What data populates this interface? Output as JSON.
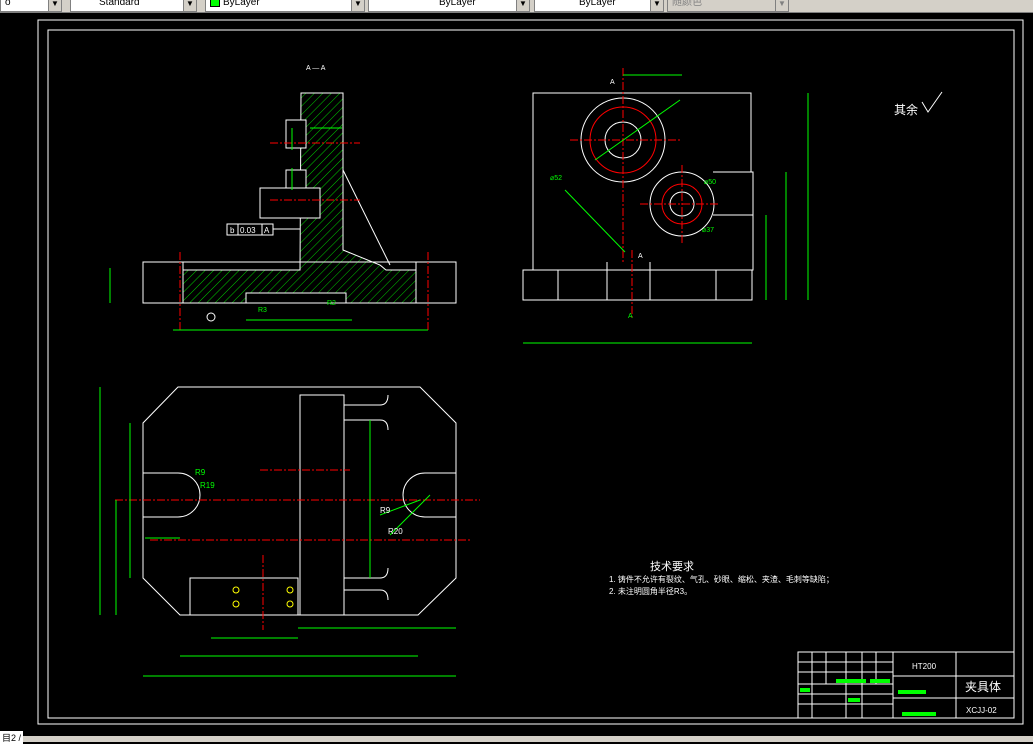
{
  "toolbar": {
    "combos": [
      {
        "id": "textstyle-left",
        "value": "o"
      },
      {
        "id": "dimstyle",
        "value": "Standard"
      },
      {
        "id": "layer",
        "value": "ByLayer"
      },
      {
        "id": "linetype",
        "value": "ByLayer"
      },
      {
        "id": "lineweight",
        "value": "ByLayer"
      },
      {
        "id": "plotstyle",
        "value": "随颜色"
      }
    ]
  },
  "drawing": {
    "section_label": "A — A",
    "roughness_note": "其余",
    "tolerance_frame": {
      "symbol": "b",
      "value": "0.03",
      "datum": "A"
    },
    "tech_requirements": {
      "title": "技术要求",
      "lines": [
        "1. 铸件不允许有裂纹、气孔、砂眼、缩松、夹渣、毛刺等缺陷；",
        "2. 未注明圆角半径R3。"
      ]
    },
    "labels": {
      "r9_left": "R9",
      "r19": "R19",
      "r9_right": "R9",
      "r20": "R20",
      "r3": "R3",
      "r2": "R2",
      "d52": "⌀52",
      "d50": "⌀50",
      "d37": "⌀37",
      "a_top": "A",
      "a_mid": "A",
      "a_bottom": "A"
    },
    "title_block": {
      "material": "HT200",
      "part_name": "夹具体",
      "drawing_no": "XCJJ-02"
    }
  },
  "command": {
    "prompt": "目2 /"
  },
  "colors": {
    "background": "#000000",
    "frame": "#ffffff",
    "dimension": "#00ff00",
    "centerline": "#ff0000",
    "hatch": "#00ff00"
  }
}
